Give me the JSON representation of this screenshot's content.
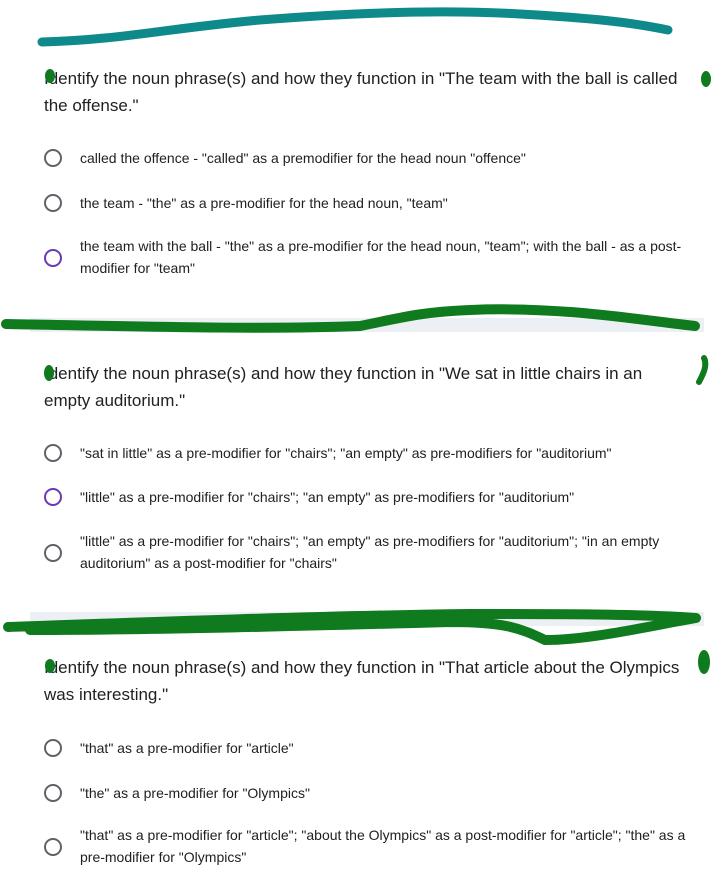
{
  "questions": [
    {
      "title": "Identify the noun phrase(s) and how they function in \"The team with the ball is called the offense.\"",
      "options": [
        {
          "label": "called the offence - \"called\" as a premodifier for the head noun \"offence\""
        },
        {
          "label": "the team - \"the\" as a pre-modifier for the head noun, \"team\""
        },
        {
          "label": "the team with the ball - \"the\" as a pre-modifier for the head noun, \"team\"; with the ball - as a post-modifier for \"team\""
        }
      ]
    },
    {
      "title": "Identify the noun phrase(s) and how they function in \"We sat in little chairs in an empty auditorium.\"",
      "options": [
        {
          "label": "\"sat in little\" as a pre-modifier for \"chairs\"; \"an empty\" as pre-modifiers for \"auditorium\""
        },
        {
          "label": "\"little\" as a pre-modifier for \"chairs\"; \"an empty\" as pre-modifiers for \"auditorium\""
        },
        {
          "label": "\"little\" as a pre-modifier for \"chairs\"; \"an empty\" as pre-modifiers for \"auditorium\"; \"in an empty auditorium\" as a post-modifier for \"chairs\""
        }
      ]
    },
    {
      "title": "Identify the noun phrase(s) and how they function in \"That article about the Olympics was interesting.\"",
      "options": [
        {
          "label": "\"that\" as a pre-modifier for \"article\""
        },
        {
          "label": "\"the\" as a pre-modifier for \"Olympics\""
        },
        {
          "label": "\"that\" as a pre-modifier for \"article\"; \"about the Olympics\" as a post-modifier for \"article\"; \"the\" as a pre-modifier for \"Olympics\""
        }
      ]
    }
  ],
  "colors": {
    "teal_marker": "#0f8a8a",
    "green_marker": "#0f7a1e",
    "radio_border": "#5f6368",
    "radio_hover": "#673ab7",
    "text": "#202124"
  }
}
